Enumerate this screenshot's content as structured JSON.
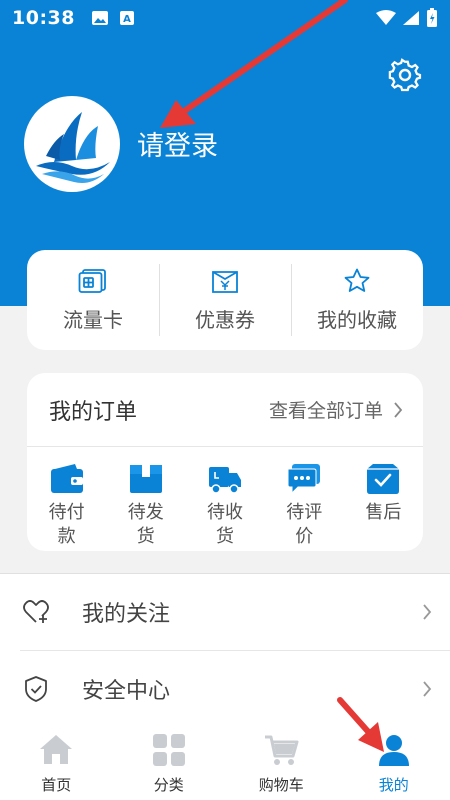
{
  "status_bar": {
    "time": "10:38"
  },
  "header": {
    "login_text": "请登录"
  },
  "quick_actions": [
    {
      "label": "流量卡",
      "icon": "sim-card-icon"
    },
    {
      "label": "优惠券",
      "icon": "coupon-icon"
    },
    {
      "label": "我的收藏",
      "icon": "star-icon"
    }
  ],
  "orders": {
    "title": "我的订单",
    "view_all": "查看全部订单",
    "items": [
      {
        "label": "待付款",
        "icon": "wallet-icon"
      },
      {
        "label": "待发货",
        "icon": "package-icon"
      },
      {
        "label": "待收货",
        "icon": "truck-icon"
      },
      {
        "label": "待评价",
        "icon": "comment-icon"
      },
      {
        "label": "售后",
        "icon": "after-sale-icon"
      }
    ]
  },
  "menu": [
    {
      "label": "我的关注",
      "icon": "heart-plus-icon"
    },
    {
      "label": "安全中心",
      "icon": "shield-check-icon"
    }
  ],
  "tabbar": [
    {
      "label": "首页",
      "icon": "home-icon"
    },
    {
      "label": "分类",
      "icon": "grid-icon"
    },
    {
      "label": "购物车",
      "icon": "cart-icon"
    },
    {
      "label": "我的",
      "icon": "user-icon",
      "active": true
    }
  ],
  "colors": {
    "primary": "#0a83d6",
    "annotation": "#e53935"
  }
}
